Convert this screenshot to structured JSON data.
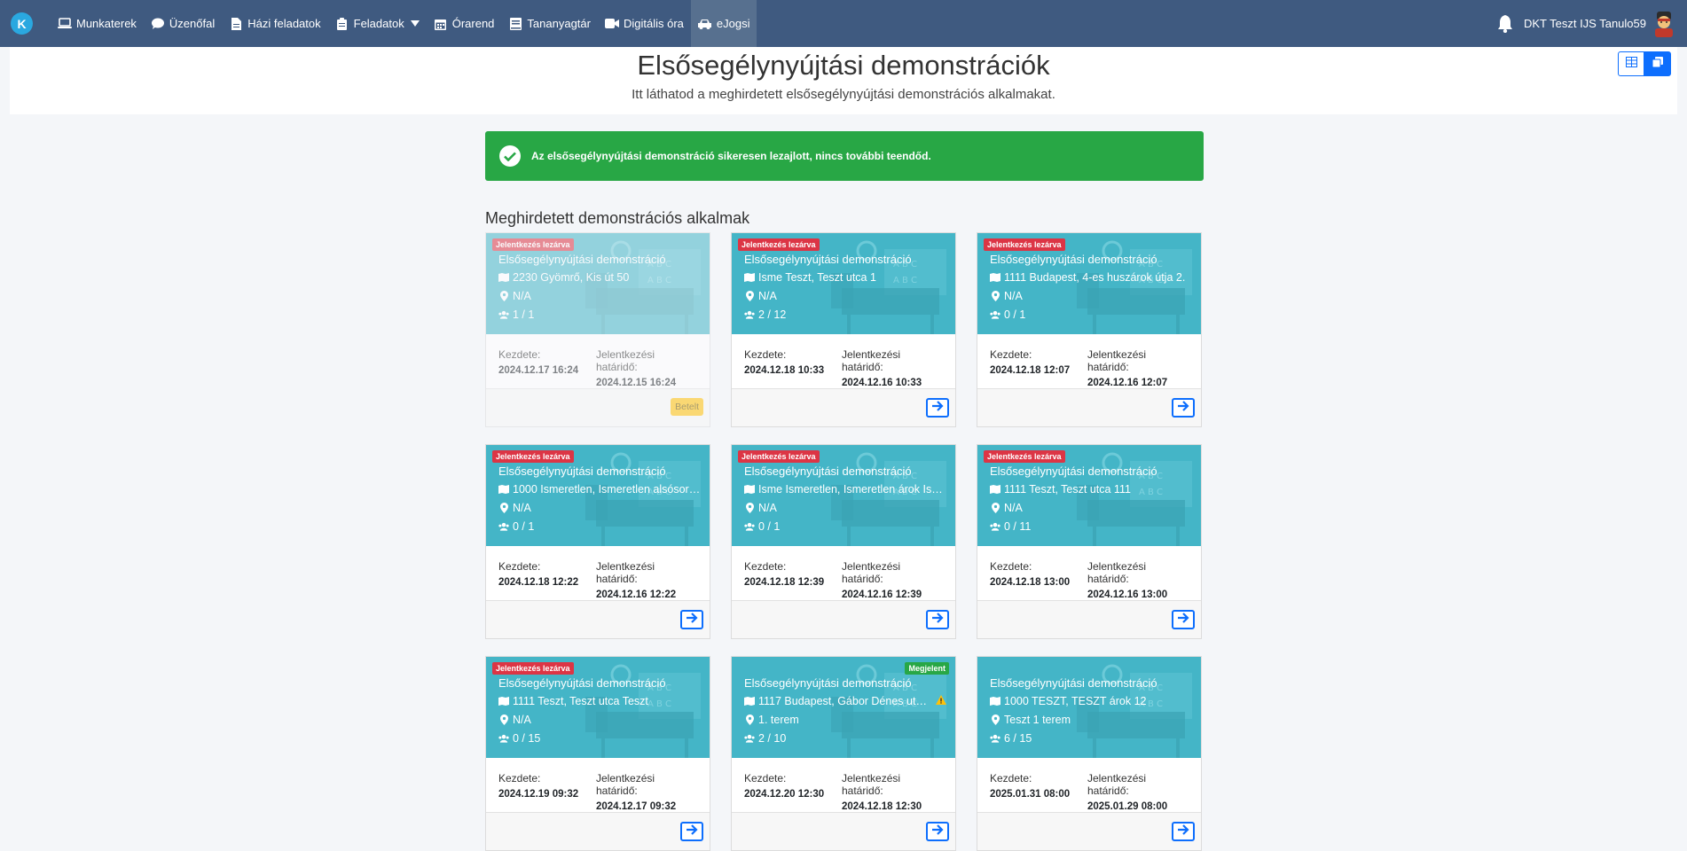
{
  "nav": {
    "brand": "K",
    "items": [
      {
        "label": "Munkaterek",
        "icon": "laptop-icon"
      },
      {
        "label": "Üzenőfal",
        "icon": "comment-icon"
      },
      {
        "label": "Házi feladatok",
        "icon": "file-icon"
      },
      {
        "label": "Feladatok",
        "icon": "clipboard-icon"
      },
      {
        "label": "Órarend",
        "icon": "calendar-icon"
      },
      {
        "label": "Tananyagtár",
        "icon": "book-icon"
      },
      {
        "label": "Digitális óra",
        "icon": "video-icon"
      },
      {
        "label": "eJogsi",
        "icon": "car-icon"
      }
    ],
    "user": "DKT Teszt IJS Tanulo59"
  },
  "header": {
    "title": "Elsősegélynyújtási demonstrációk",
    "subtitle": "Itt láthatod a meghirdetett elsősegélynyújtási demonstrációs alkalmakat."
  },
  "alert": {
    "text": "Az elsősegélynyújtási demonstráció sikeresen lezajlott, nincs további teendőd."
  },
  "section": {
    "title": "Meghirdetett demonstrációs alkalmak"
  },
  "labels": {
    "start": "Kezdete:",
    "deadline": "Jelentkezési határidő:"
  },
  "cards": [
    {
      "badge": "Jelentkezés lezárva",
      "title": "Elsősegélynyújtási demonstráció",
      "address": "2230 Gyömrő, Kis út 50",
      "room": "N/A",
      "people": "1 / 1",
      "start": "2024.12.17 16:24",
      "deadline": "2024.12.15 16:24",
      "action": "Betelt"
    },
    {
      "badge": "Jelentkezés lezárva",
      "title": "Elsősegélynyújtási demonstráció",
      "address": "Isme Teszt, Teszt utca 1",
      "room": "N/A",
      "people": "2 / 12",
      "start": "2024.12.18 10:33",
      "deadline": "2024.12.16 10:33",
      "action": ""
    },
    {
      "badge": "Jelentkezés lezárva",
      "title": "Elsősegélynyújtási demonstráció",
      "address": "1111 Budapest, 4-es huszárok útja 2.",
      "room": "N/A",
      "people": "0 / 1",
      "start": "2024.12.18 12:07",
      "deadline": "2024.12.16 12:07",
      "action": ""
    },
    {
      "badge": "Jelentkezés lezárva",
      "title": "Elsősegélynyújtási demonstráció",
      "address": "1000 Ismeretlen, Ismeretlen alsósor I...",
      "room": "N/A",
      "people": "0 / 1",
      "start": "2024.12.18 12:22",
      "deadline": "2024.12.16 12:22",
      "action": ""
    },
    {
      "badge": "Jelentkezés lezárva",
      "title": "Elsősegélynyújtási demonstráció",
      "address": "Isme Ismeretlen, Ismeretlen árok Ism...",
      "room": "N/A",
      "people": "0 / 1",
      "start": "2024.12.18 12:39",
      "deadline": "2024.12.16 12:39",
      "action": ""
    },
    {
      "badge": "Jelentkezés lezárva",
      "title": "Elsősegélynyújtási demonstráció",
      "address": "1111 Teszt, Teszt utca 111",
      "room": "N/A",
      "people": "0 / 11",
      "start": "2024.12.18 13:00",
      "deadline": "2024.12.16 13:00",
      "action": ""
    },
    {
      "badge": "Jelentkezés lezárva",
      "title": "Elsősegélynyújtási demonstráció",
      "address": "1111 Teszt, Teszt utca Teszt",
      "room": "N/A",
      "people": "0 / 15",
      "start": "2024.12.19 09:32",
      "deadline": "2024.12.17 09:32",
      "action": ""
    },
    {
      "badge": "Megjelent",
      "title": "Elsősegélynyújtási demonstráció",
      "address": "1117 Budapest, Gábor Dénes utca ...",
      "room": "1. terem",
      "people": "2 / 10",
      "start": "2024.12.20 12:30",
      "deadline": "2024.12.18 12:30",
      "action": ""
    },
    {
      "badge": "",
      "title": "Elsősegélynyújtási demonstráció",
      "address": "1000 TESZT, TESZT árok 12",
      "room": "Teszt 1 terem",
      "people": "6 / 15",
      "start": "2025.01.31 08:00",
      "deadline": "2025.01.29 08:00",
      "action": ""
    }
  ]
}
